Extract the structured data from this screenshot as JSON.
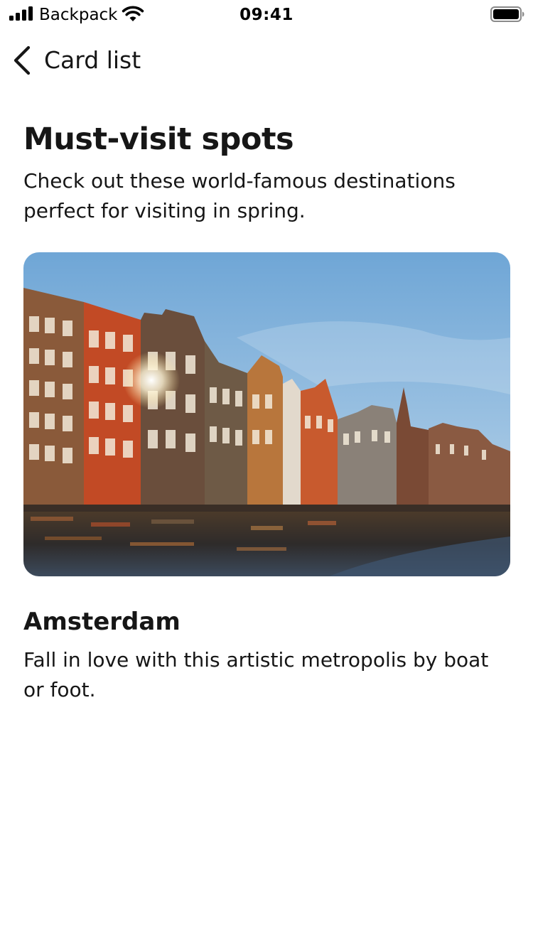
{
  "status_bar": {
    "carrier": "Backpack",
    "time": "09:41",
    "icons": [
      "signal-icon",
      "wifi-icon",
      "battery-icon"
    ]
  },
  "nav": {
    "back_icon": "chevron-left-icon",
    "title": "Card list"
  },
  "header": {
    "title": "Must-visit spots",
    "subtitle": "Check out these world-famous destinations perfect for visiting in spring."
  },
  "cards": [
    {
      "title": "Amsterdam",
      "description": "Fall in love with this artistic metropolis by boat or foot.",
      "image_subject": "canal houses"
    }
  ],
  "colors": {
    "text": "#161616",
    "background": "#ffffff"
  }
}
